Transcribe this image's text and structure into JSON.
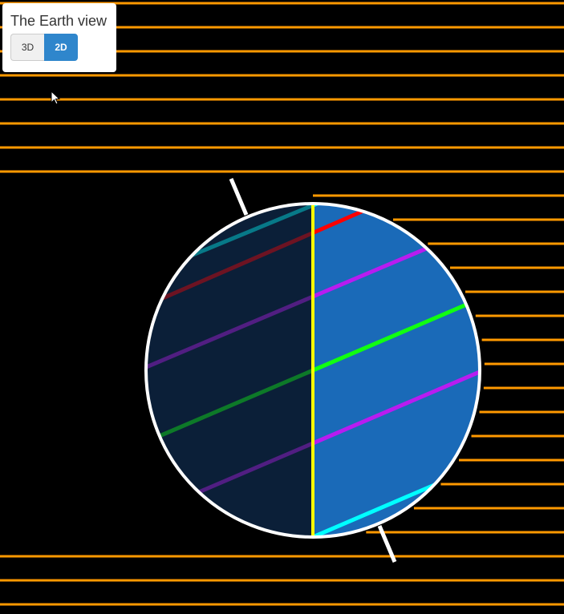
{
  "panel": {
    "title": "The Earth view",
    "buttons": [
      {
        "label": "3D",
        "active": false
      },
      {
        "label": "2D",
        "active": true
      }
    ]
  },
  "colors": {
    "sun_rays": "#ff9900",
    "ocean_day": "#1a6ab8",
    "ocean_night": "#0b2039",
    "outline": "#ffffff",
    "meridian": "#ffff00",
    "arctic_circle": "#ff0000",
    "tropic": "#b81cf0",
    "equator": "#11ff11",
    "antarctic_circle": "#00ffff",
    "axis": "#ffffff",
    "active_button": "#2f86cc"
  },
  "icons": {
    "cursor": "mouse-pointer-icon"
  }
}
